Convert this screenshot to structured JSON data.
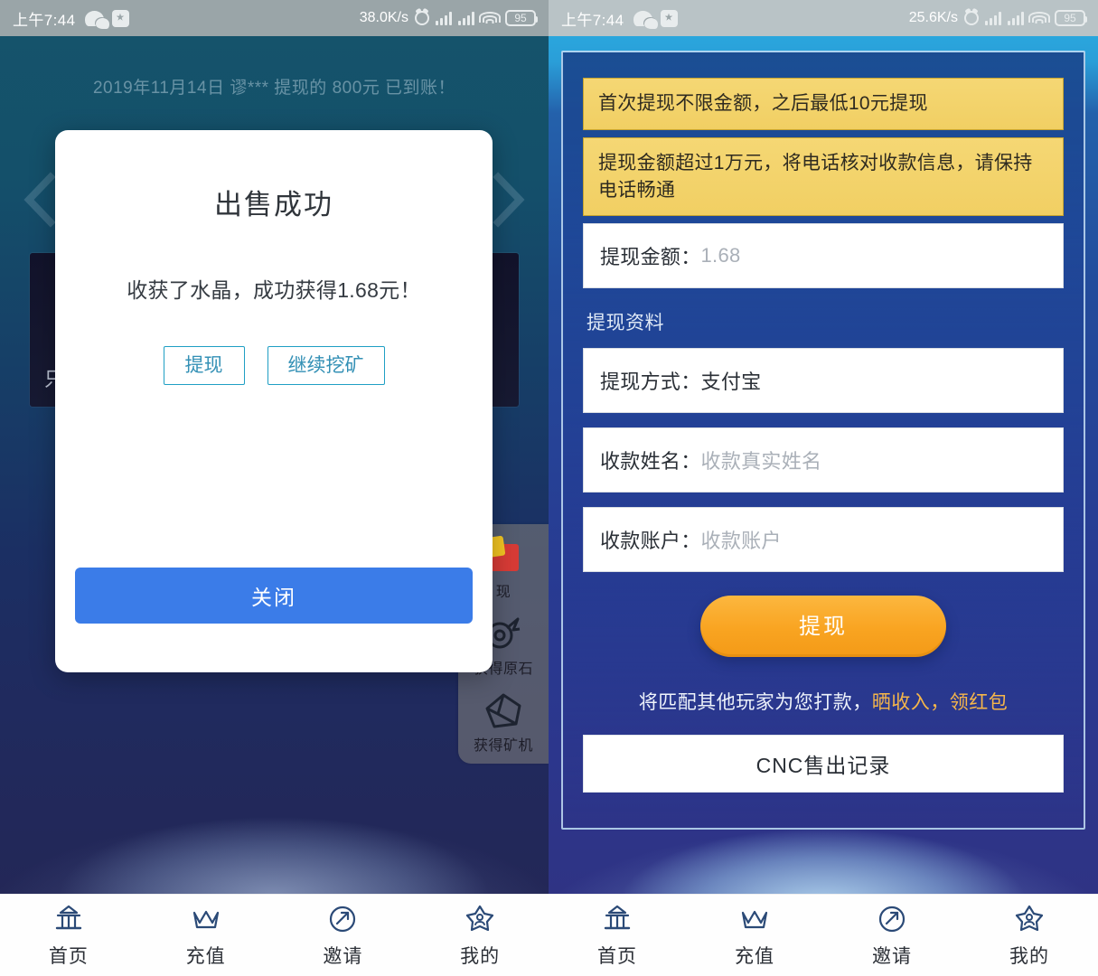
{
  "status_bar": {
    "left": {
      "time": "上午7:44",
      "network_speed": "38.0K/s",
      "battery": "95",
      "icons": [
        "wechat-icon",
        "app-icon",
        "alarm-icon",
        "signal-bars-icon",
        "signal-bars-icon",
        "wifi-icon",
        "battery-icon"
      ]
    },
    "right": {
      "time": "上午7:44",
      "network_speed": "25.6K/s",
      "battery": "95",
      "icons": [
        "wechat-icon",
        "app-icon",
        "alarm-icon",
        "signal-bars-icon",
        "signal-bars-icon",
        "wifi-icon",
        "battery-icon"
      ]
    }
  },
  "left_screen": {
    "marquee": "2019年11月14日 谬*** 提现的 800元 已到账！",
    "card_text": "只",
    "side_dock": [
      {
        "label": "现",
        "icon": "gift-icon"
      },
      {
        "label": "获得原石",
        "icon": "raw-stone-icon"
      },
      {
        "label": "获得矿机",
        "icon": "mining-machine-icon"
      }
    ],
    "dialog": {
      "title": "出售成功",
      "message": "收获了水晶，成功获得1.68元！",
      "primary_action": "提现",
      "secondary_action": "继续挖矿",
      "close_label": "关闭",
      "close_color": "#3b7ce8",
      "action_border_color": "#1f9fc4"
    }
  },
  "right_screen": {
    "notices": [
      "首次提现不限金额，之后最低10元提现",
      "提现金额超过1万元，将电话核对收款信息，请保持电话畅通"
    ],
    "notice_color": "#f1cf63",
    "amount_field": {
      "label": "提现金额：",
      "value": "1.68"
    },
    "section_label": "提现资料",
    "fields": [
      {
        "label": "提现方式：",
        "value": "支付宝",
        "is_placeholder": false
      },
      {
        "label": "收款姓名：",
        "value": "收款真实姓名",
        "is_placeholder": true
      },
      {
        "label": "收款账户：",
        "value": "收款账户",
        "is_placeholder": true
      }
    ],
    "withdraw_button": {
      "label": "提现",
      "color": "#f9a421"
    },
    "tagline": {
      "prefix": "将匹配其他玩家为您打款，",
      "highlight": "晒收入，领红包",
      "highlight_color": "#f6b64a"
    },
    "record_button": "CNC售出记录"
  },
  "tabbar": {
    "items": [
      {
        "label": "首页",
        "icon": "temple-icon"
      },
      {
        "label": "充值",
        "icon": "crown-icon"
      },
      {
        "label": "邀请",
        "icon": "share-arrow-icon"
      },
      {
        "label": "我的",
        "icon": "star-person-icon"
      }
    ],
    "icon_color": "#2b4a77"
  }
}
